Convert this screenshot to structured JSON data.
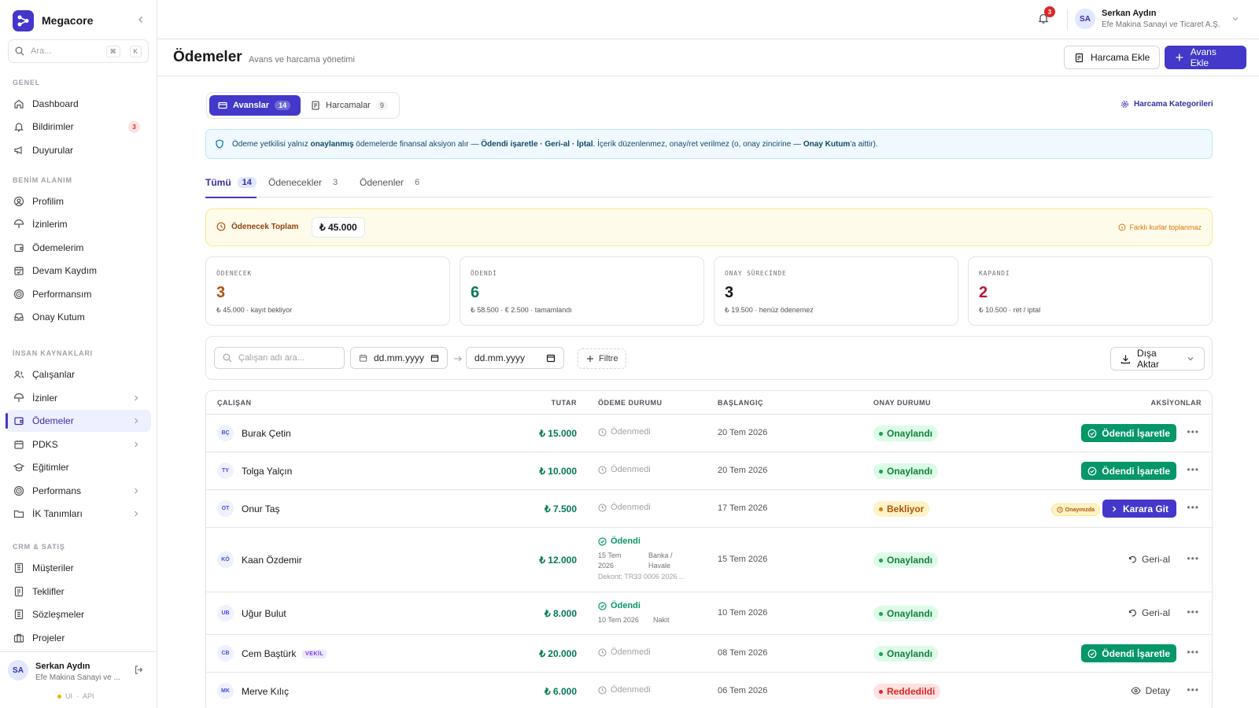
{
  "app": {
    "name": "Megacore"
  },
  "sidebar": {
    "search_placeholder": "Ara...",
    "kbd1": "⌘",
    "kbd2": "K",
    "sections": {
      "genel": "GENEL",
      "benim": "BENİM ALANIM",
      "ik": "İNSAN KAYNAKLARI",
      "crm": "CRM & SATIŞ"
    },
    "items": {
      "dashboard": "Dashboard",
      "bildirimler": "Bildirimler",
      "bildirimler_badge": "3",
      "duyurular": "Duyurular",
      "profilim": "Profilim",
      "izinlerim": "İzinlerim",
      "odemelerim": "Ödemelerim",
      "devam": "Devam Kaydım",
      "performansim": "Performansım",
      "onay": "Onay Kutum",
      "calisanlar": "Çalışanlar",
      "izinler": "İzinler",
      "odemeler": "Ödemeler",
      "pdks": "PDKS",
      "egitimler": "Eğitimler",
      "performans": "Performans",
      "ik_tanimlari": "İK Tanımları",
      "musteriler": "Müşteriler",
      "teklifler": "Teklifler",
      "sozlesmeler": "Sözleşmeler",
      "projeler": "Projeler"
    },
    "footer": {
      "initials": "SA",
      "name": "Serkan Aydın",
      "company": "Efe Makina Sanayi ve ...",
      "ui": "UI",
      "api": "API",
      "sep": "·"
    }
  },
  "topbar": {
    "bell_count": "3",
    "user_initials": "SA",
    "user_name": "Serkan Aydın",
    "user_company": "Efe Makina Sanayi ve Ticaret A.Ş."
  },
  "page": {
    "title": "Ödemeler",
    "subtitle": "Avans ve harcama yönetimi",
    "btn_harcama": "Harcama Ekle",
    "btn_avans": "Avans Ekle"
  },
  "segment": {
    "avans": "Avanslar",
    "avans_count": "14",
    "harcama": "Harcamalar",
    "harcama_count": "9"
  },
  "categories_link": "Harcama Kategorileri",
  "info": {
    "p1": "Ödeme yetkilisi yalnız ",
    "b1": "onaylanmış",
    "p2": " ödemelerde finansal aksiyon alır — ",
    "b2": "Ödendi işaretle · Geri-al · İptal",
    "p3": ". İçerik düzenlenmez, onay/ret verilmez (o, onay zincirine — ",
    "b3": "Onay Kutum",
    "p4": "'a aittir)."
  },
  "tabs": [
    {
      "label": "Tümü",
      "count": "14"
    },
    {
      "label": "Ödenecekler",
      "count": "3"
    },
    {
      "label": "Ödenenler",
      "count": "6"
    }
  ],
  "total": {
    "label": "Ödenecek Toplam",
    "value": "₺ 45.000",
    "note": "Farklı kurlar toplanmaz"
  },
  "stats": [
    {
      "label": "ÖDENECEK",
      "value": "3",
      "sub": "₺ 45.000 · kayıt bekliyor",
      "color": "#b45309"
    },
    {
      "label": "ÖDENDİ",
      "value": "6",
      "sub": "₺ 58.500 · € 2.500 · tamamlandı",
      "color": "#047857"
    },
    {
      "label": "ONAY SÜRECİNDE",
      "value": "3",
      "sub": "₺ 19.500 · henüz ödenemez",
      "color": "#18181b"
    },
    {
      "label": "KAPANDI",
      "value": "2",
      "sub": "₺ 10.500 · ret / iptal",
      "color": "#be123c"
    }
  ],
  "filters": {
    "search_placeholder": "Çalışan adı ara...",
    "date_from": "dd.mm.yyyy",
    "date_to": "dd.mm.yyyy",
    "filter": "Filtre",
    "export": "Dışa Aktar"
  },
  "table": {
    "headers": {
      "employee": "ÇALIŞAN",
      "amount": "TUTAR",
      "payment": "ÖDEME DURUMU",
      "start": "BAŞLANGIÇ",
      "approval": "ONAY DURUMU",
      "actions": "AKSİYONLAR"
    },
    "rows": [
      {
        "initials": "BÇ",
        "name": "Burak Çetin",
        "amount": "₺ 15.000",
        "payment": "Ödenmedi",
        "date": "20 Tem 2026",
        "approval": "Onaylandı",
        "action": "Ödendi İşaretle"
      },
      {
        "initials": "TY",
        "name": "Tolga Yalçın",
        "amount": "₺ 10.000",
        "payment": "Ödenmedi",
        "date": "20 Tem 2026",
        "approval": "Onaylandı",
        "action": "Ödendi İşaretle"
      },
      {
        "initials": "OT",
        "name": "Onur Taş",
        "amount": "₺ 7.500",
        "payment": "Ödenmedi",
        "date": "17 Tem 2026",
        "approval": "Bekliyor",
        "badge": "Onayınızda",
        "action": "Karara Git"
      },
      {
        "initials": "KÖ",
        "name": "Kaan Özdemir",
        "amount": "₺ 12.000",
        "payment": "Ödendi",
        "pay_date1": "15 Tem",
        "pay_date2": "2026",
        "pay_method1": "Banka /",
        "pay_method2": "Havale",
        "dekont": "Dekont: TR33 0006 2026 ...",
        "date": "15 Tem 2026",
        "approval": "Onaylandı",
        "action": "Geri-al"
      },
      {
        "initials": "UB",
        "name": "Uğur Bulut",
        "amount": "₺ 8.000",
        "payment": "Ödendi",
        "pay_date": "10 Tem 2026",
        "pay_method": "Nakit",
        "date": "10 Tem 2026",
        "approval": "Onaylandı",
        "action": "Geri-al"
      },
      {
        "initials": "CB",
        "name": "Cem Baştürk",
        "vekil": "VEKİL",
        "amount": "₺ 20.000",
        "payment": "Ödenmedi",
        "date": "08 Tem 2026",
        "approval": "Onaylandı",
        "action": "Ödendi İşaretle"
      },
      {
        "initials": "MK",
        "name": "Merve Kılıç",
        "amount": "₺ 6.000",
        "payment": "Ödenmedi",
        "date": "06 Tem 2026",
        "approval": "Reddedildi",
        "action": "Detay"
      }
    ]
  }
}
